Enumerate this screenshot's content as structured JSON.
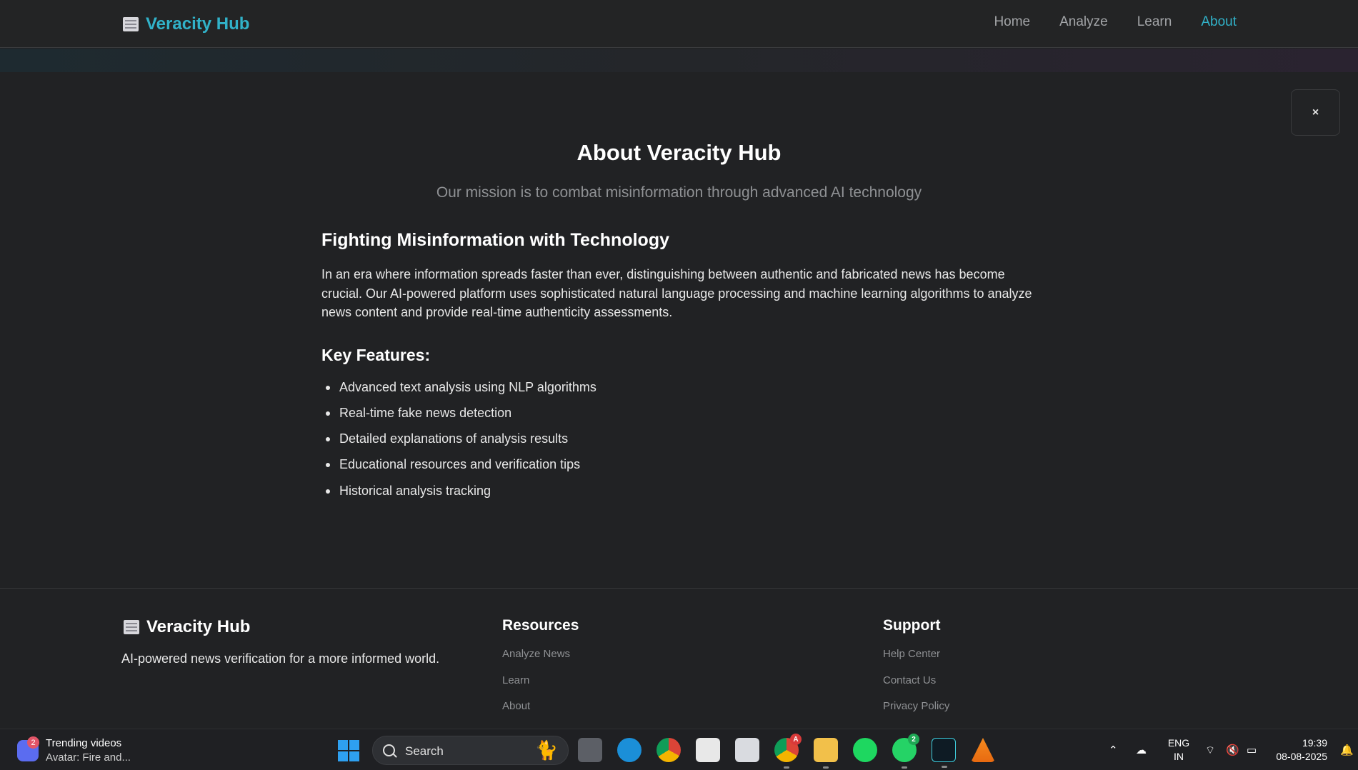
{
  "nav": {
    "brand": "Veracity Hub",
    "links": [
      {
        "label": "Home",
        "active": false
      },
      {
        "label": "Analyze",
        "active": false
      },
      {
        "label": "Learn",
        "active": false
      },
      {
        "label": "About",
        "active": true
      }
    ],
    "accent_color": "#31b2c9"
  },
  "modal": {
    "close_label": "×"
  },
  "about": {
    "title": "About Veracity Hub",
    "subtitle": "Our mission is to combat misinformation through advanced AI technology",
    "section_heading": "Fighting Misinformation with Technology",
    "paragraph": "In an era where information spreads faster than ever, distinguishing between authentic and fabricated news has become crucial. Our AI-powered platform uses sophisticated natural language processing and machine learning algorithms to analyze news content and provide real-time authenticity assessments.",
    "features_heading": "Key Features:",
    "features": [
      "Advanced text analysis using NLP algorithms",
      "Real-time fake news detection",
      "Detailed explanations of analysis results",
      "Educational resources and verification tips",
      "Historical analysis tracking"
    ]
  },
  "footer": {
    "brand": "Veracity Hub",
    "tagline": "AI-powered news verification for a more informed world.",
    "resources": {
      "heading": "Resources",
      "links": [
        "Analyze News",
        "Learn",
        "About"
      ]
    },
    "support": {
      "heading": "Support",
      "links": [
        "Help Center",
        "Contact Us",
        "Privacy Policy"
      ]
    }
  },
  "taskbar": {
    "widget_badge": "2",
    "widget_title": "Trending videos",
    "widget_subtitle": "Avatar: Fire and...",
    "search_label": "Search",
    "chrome_badge": "A",
    "whatsapp_badge": "2",
    "lang_line1": "ENG",
    "lang_line2": "IN",
    "time": "19:39",
    "date": "08-08-2025"
  }
}
